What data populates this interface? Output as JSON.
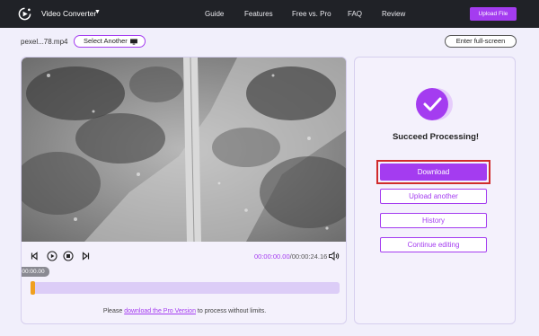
{
  "header": {
    "app_name": "Video Converter",
    "nav": [
      "Guide",
      "Features",
      "Free vs. Pro",
      "FAQ",
      "Review"
    ],
    "upload_label": "Upload File"
  },
  "file": {
    "name": "pexel...78.mp4",
    "select_another_label": "Select Another",
    "fullscreen_label": "Enter full-screen"
  },
  "player": {
    "current_time": "00:00:00.00",
    "duration": "/00:00:24.16",
    "timeline_badge": "00:00:00.00",
    "progress": 0
  },
  "note": {
    "before": "Please ",
    "link": "download the Pro Version",
    "after": " to process without limits."
  },
  "result": {
    "title": "Succeed Processing!",
    "download_label": "Download",
    "upload_another_label": "Upload another",
    "history_label": "History",
    "continue_label": "Continue editing"
  },
  "colors": {
    "accent": "#a43cf0",
    "topbar": "#202227",
    "highlight": "#d02b2b",
    "timeline_handle": "#f0a020"
  }
}
